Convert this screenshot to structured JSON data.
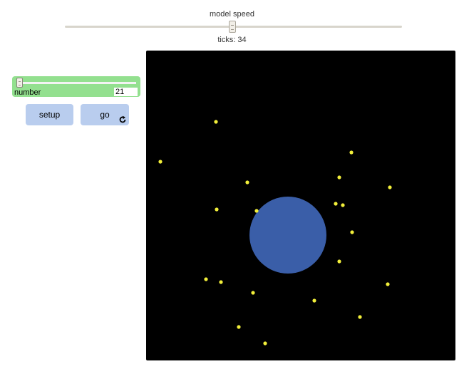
{
  "model_speed": {
    "label": "model speed"
  },
  "ticks": {
    "label": "ticks: 34"
  },
  "number_slider": {
    "name": "number",
    "value": "21"
  },
  "buttons": {
    "setup_label": "setup",
    "go_label": "go",
    "go_forever_icon": "forever-arrow-icon"
  },
  "world": {
    "background": "#000000",
    "center_circle_color": "#3a5ea8",
    "particle_color": "#f2ef3a"
  }
}
